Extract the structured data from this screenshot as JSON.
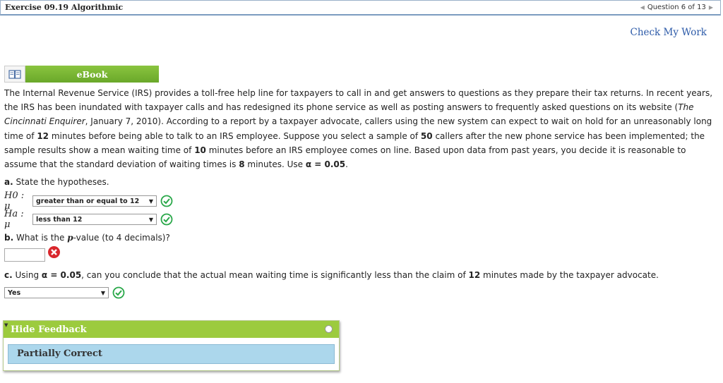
{
  "header": {
    "title": "Exercise 09.19 Algorithmic",
    "question_indicator": "Question 6 of 13"
  },
  "check_work_label": "Check My Work",
  "ebook_label": "eBook",
  "problem": {
    "s1": "The Internal Revenue Service (IRS) provides a toll-free help line for taxpayers to call in and get answers to questions as they prepare their tax returns. In recent years, the IRS has been inundated with taxpayer calls and has redesigned its phone service as well as posting answers to frequently asked questions on its website (",
    "source": "The Cincinnati Enquirer",
    "s2": ", January 7, 2010). According to a report by a taxpayer advocate, callers using the new system can expect to wait on hold for an unreasonably long time of ",
    "wait": "12",
    "s3": " minutes before being able to talk to an IRS employee. Suppose you select a sample of ",
    "n": "50",
    "s4": " callers after the new phone service has been implemented; the sample results show a mean waiting time of ",
    "mean": "10",
    "s5": " minutes before an IRS employee comes on line. Based upon data from past years, you decide it is reasonable to assume that the standard deviation of waiting times is ",
    "sd": "8",
    "s6": " minutes. Use ",
    "alpha": "α = 0.05",
    "s7": "."
  },
  "part_a": {
    "letter": "a.",
    "text": " State the hypotheses.",
    "h0_label": "H0 : μ",
    "h0_value": "greater than or equal to 12",
    "ha_label": "Ha : μ",
    "ha_value": "less than 12"
  },
  "part_b": {
    "letter": "b.",
    "t1": " What is the ",
    "pvar": "p",
    "t2": "-value (to 4 decimals)?",
    "answer": ""
  },
  "part_c": {
    "letter": "c.",
    "t1": " Using ",
    "alpha": "α = 0.05",
    "t2": ", can you conclude that the actual mean waiting time is significantly less than the claim of ",
    "claim": "12",
    "t3": " minutes made by the taxpayer advocate.",
    "answer": "Yes"
  },
  "feedback": {
    "toggle_label": "Hide Feedback",
    "message": "Partially Correct"
  },
  "colors": {
    "accent_green": "#8ac43f",
    "link_blue": "#2c5aa8",
    "correct_green": "#2aa84a",
    "wrong_red": "#d9262c",
    "feedback_blue": "#acd7ec"
  },
  "icons": [
    "book-icon",
    "check-circle-icon",
    "x-circle-icon",
    "pin-icon",
    "triangle-left-icon",
    "triangle-right-icon",
    "caret-down-icon"
  ]
}
